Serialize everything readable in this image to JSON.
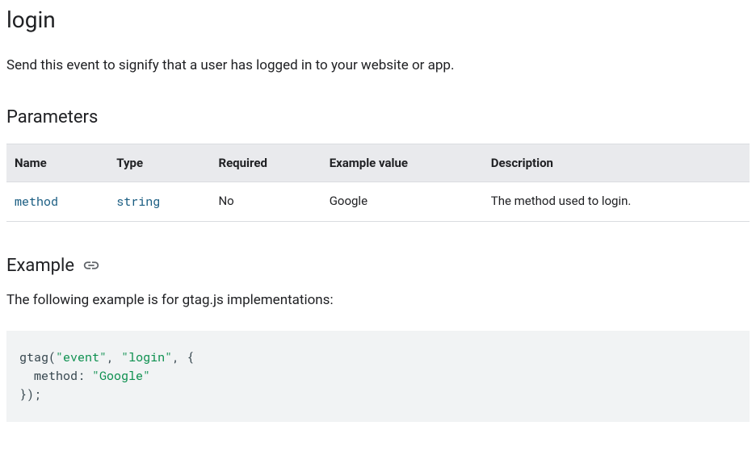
{
  "heading": "login",
  "description": "Send this event to signify that a user has logged in to your website or app.",
  "parameters": {
    "title": "Parameters",
    "columns": [
      "Name",
      "Type",
      "Required",
      "Example value",
      "Description"
    ],
    "rows": [
      {
        "name": "method",
        "type": "string",
        "required": "No",
        "example_value": "Google",
        "description": "The method used to login."
      }
    ]
  },
  "example": {
    "title": "Example",
    "intro": "The following example is for gtag.js implementations:",
    "code": {
      "fn": "gtag",
      "args_str1": "\"event\"",
      "args_str2": "\"login\"",
      "obj_key": "method",
      "obj_val": "\"Google\""
    }
  }
}
